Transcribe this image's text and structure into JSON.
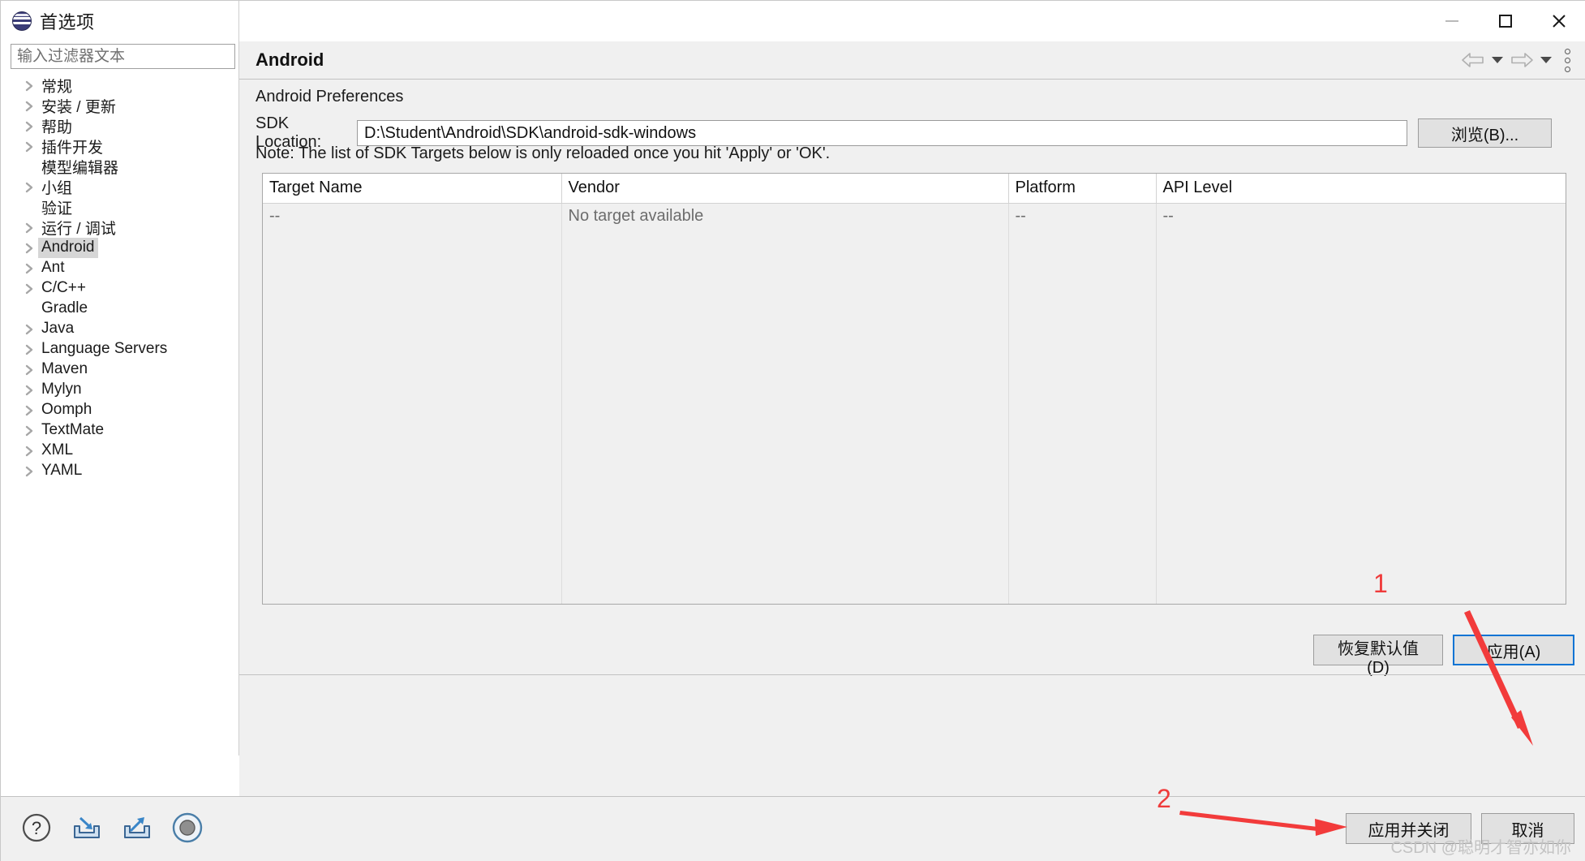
{
  "window": {
    "title": "首选项",
    "icon": "eclipse-globe-icon",
    "controls": {
      "minimize": "minimize-icon",
      "maximize": "maximize-icon",
      "close": "close-icon"
    }
  },
  "sidebar": {
    "filter_placeholder": "输入过滤器文本",
    "filter_value": "",
    "items": [
      {
        "label": "常规",
        "expandable": true,
        "selected": false
      },
      {
        "label": "安装 / 更新",
        "expandable": true,
        "selected": false
      },
      {
        "label": "帮助",
        "expandable": true,
        "selected": false
      },
      {
        "label": "插件开发",
        "expandable": true,
        "selected": false
      },
      {
        "label": "模型编辑器",
        "expandable": false,
        "selected": false
      },
      {
        "label": "小组",
        "expandable": true,
        "selected": false
      },
      {
        "label": "验证",
        "expandable": false,
        "selected": false
      },
      {
        "label": "运行 / 调试",
        "expandable": true,
        "selected": false
      },
      {
        "label": "Android",
        "expandable": true,
        "selected": true
      },
      {
        "label": "Ant",
        "expandable": true,
        "selected": false
      },
      {
        "label": "C/C++",
        "expandable": true,
        "selected": false
      },
      {
        "label": "Gradle",
        "expandable": false,
        "selected": false
      },
      {
        "label": "Java",
        "expandable": true,
        "selected": false
      },
      {
        "label": "Language Servers",
        "expandable": true,
        "selected": false
      },
      {
        "label": "Maven",
        "expandable": true,
        "selected": false
      },
      {
        "label": "Mylyn",
        "expandable": true,
        "selected": false
      },
      {
        "label": "Oomph",
        "expandable": true,
        "selected": false
      },
      {
        "label": "TextMate",
        "expandable": true,
        "selected": false
      },
      {
        "label": "XML",
        "expandable": true,
        "selected": false
      },
      {
        "label": "YAML",
        "expandable": true,
        "selected": false
      }
    ]
  },
  "page": {
    "title": "Android",
    "nav": {
      "back": "back-arrow-icon",
      "back_caret": "chevron-down-icon",
      "forward": "forward-arrow-icon",
      "forward_caret": "chevron-down-icon",
      "menu": "kebab-menu-icon"
    },
    "section_label": "Android Preferences",
    "sdk_location_label": "SDK Location:",
    "sdk_location_value": "D:\\Student\\Android\\SDK\\android-sdk-windows",
    "sdk_location_placeholder": "",
    "browse_button": "浏览(B)...",
    "note": "Note: The list of SDK Targets below is only reloaded once you hit 'Apply' or 'OK'.",
    "table": {
      "columns": [
        "Target Name",
        "Vendor",
        "Platform",
        "API Level"
      ],
      "rows": [
        {
          "target_name": "--",
          "vendor": "No target available",
          "platform": "--",
          "api_level": "--"
        }
      ]
    },
    "restore_defaults_button": "恢复默认值(D)",
    "apply_button": "应用(A)"
  },
  "footer": {
    "icons": [
      {
        "name": "help-icon"
      },
      {
        "name": "import-icon"
      },
      {
        "name": "export-icon"
      },
      {
        "name": "record-icon"
      }
    ],
    "apply_and_close_button": "应用并关闭",
    "cancel_button": "取消",
    "watermark": "CSDN @聪明才智亦如你"
  },
  "annotations": {
    "accent_color": "#ef3b3b",
    "markers": [
      {
        "label": "1",
        "points_to": "apply-button"
      },
      {
        "label": "2",
        "points_to": "apply-and-close-button"
      }
    ]
  }
}
